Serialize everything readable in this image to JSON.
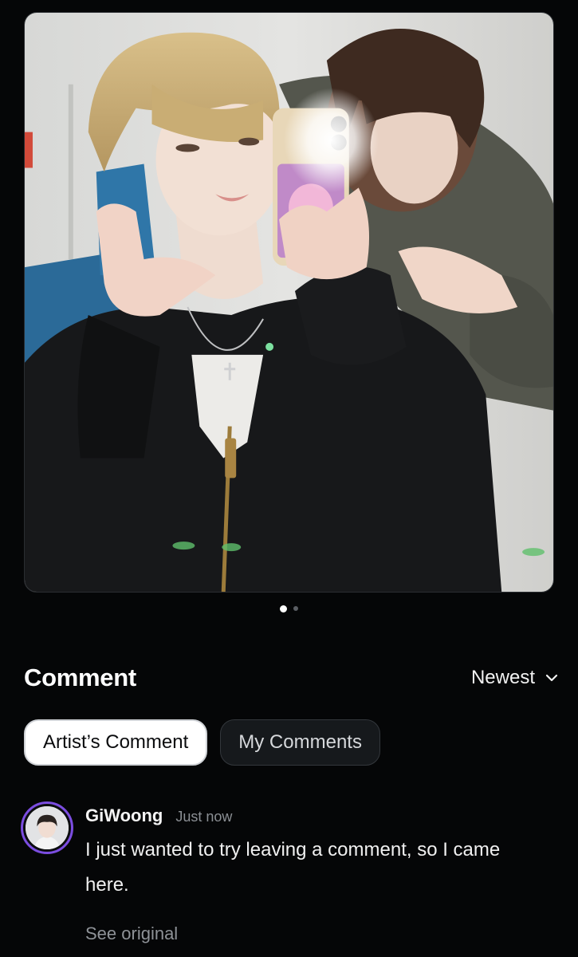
{
  "carousel": {
    "current_index": 1,
    "total": 2
  },
  "comments_section": {
    "title": "Comment",
    "sort_label": "Newest"
  },
  "tabs": [
    {
      "label": "Artist’s Comment",
      "active": true
    },
    {
      "label": "My Comments",
      "active": false
    }
  ],
  "comment": {
    "author": "GiWoong",
    "time": "Just now",
    "text": "I just wanted to try leaving a comment, so I came here.",
    "see_original": "See original"
  },
  "colors": {
    "background": "#050607",
    "avatar_ring": "#7b4de0",
    "muted_text": "#8b8f94"
  }
}
